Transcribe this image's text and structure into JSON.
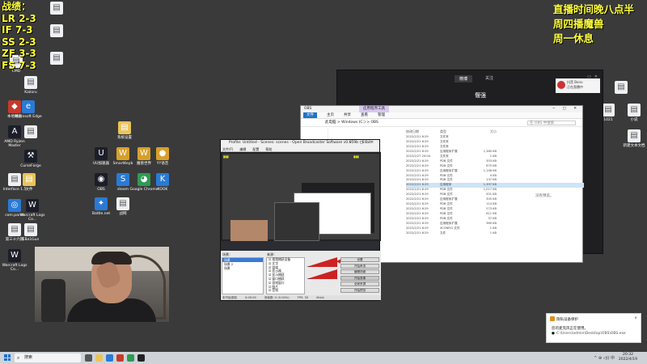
{
  "overlay": {
    "left_lines": [
      "战绩：",
      "LR 2-3",
      "IF 7-3",
      "SS 2-3",
      "ZF 3-3",
      "FS 7-3"
    ],
    "right_lines": [
      "直播时间晚八点半",
      "周四播魔兽",
      "周一休息"
    ]
  },
  "desktop_icons": [
    {
      "label": "",
      "glyph": "▤",
      "style": "g-doc"
    },
    {
      "label": "CMD",
      "glyph": "▤",
      "style": "g-doc"
    },
    {
      "label": "",
      "glyph": "▤",
      "style": "g-doc"
    },
    {
      "label": "",
      "glyph": "▤",
      "style": "g-doc"
    },
    {
      "label": "Kailoru",
      "glyph": "▤",
      "style": "g-doc"
    },
    {
      "label": "本地磁盘",
      "glyph": "◆",
      "style": "g-red"
    },
    {
      "label": "Microsoft Edge",
      "glyph": "e",
      "style": "g-blue"
    },
    {
      "label": "AMD Ryzen Master",
      "glyph": "A",
      "style": "g-dark"
    },
    {
      "label": "",
      "glyph": "▤",
      "style": "g-doc"
    },
    {
      "label": "CurseForge",
      "glyph": "⚒",
      "style": "g-dark"
    },
    {
      "label": "Interface 1.5",
      "glyph": "▤",
      "style": "g-doc"
    },
    {
      "label": "文件",
      "glyph": "▤",
      "style": "g-folder"
    },
    {
      "label": "com.parse",
      "glyph": "◎",
      "style": "g-blue"
    },
    {
      "label": "Warcraft Logs Co...",
      "glyph": "W",
      "style": "g-dark"
    },
    {
      "label": "第三十六期",
      "glyph": "▤",
      "style": "g-doc"
    },
    {
      "label": "Warcraft Logs Co...",
      "glyph": "W",
      "style": "g-dark"
    },
    {
      "label": "EBa1Gun",
      "glyph": "▤",
      "style": "g-doc"
    },
    {
      "label": "系统设置",
      "glyph": "▤",
      "style": "g-folder"
    },
    {
      "label": "UU加速器",
      "glyph": "U",
      "style": "g-dark"
    },
    {
      "label": "SmartKeyb",
      "glyph": "W",
      "style": "g-gold"
    },
    {
      "label": "OBS",
      "glyph": "◉",
      "style": "g-dark"
    },
    {
      "label": "steam",
      "glyph": "S",
      "style": "g-blue"
    },
    {
      "label": "Battle.net",
      "glyph": "✦",
      "style": "g-blue"
    },
    {
      "label": "战网",
      "glyph": "▤",
      "style": "g-doc"
    },
    {
      "label": "魔兽世界",
      "glyph": "W",
      "style": "g-gold"
    },
    {
      "label": "Google Chrome",
      "glyph": "◕",
      "style": "g-green"
    },
    {
      "label": "YY语音",
      "glyph": "●",
      "style": "g-gold"
    },
    {
      "label": "KOOK",
      "glyph": "K",
      "style": "g-blue"
    },
    {
      "label": "",
      "glyph": "▤",
      "style": "g-doc"
    },
    {
      "label": "新建文本文档",
      "glyph": "▤",
      "style": "g-doc"
    },
    {
      "label": "1021",
      "glyph": "▤",
      "style": "g-doc"
    },
    {
      "label": "小说",
      "glyph": "▤",
      "style": "g-doc"
    }
  ],
  "player": {
    "tabs": [
      "微博",
      "关注"
    ],
    "nick": "偃强",
    "notice_title": "抖音 Bonu",
    "notice_sub": "正在直播中"
  },
  "explorer": {
    "title": "OBS",
    "tool_tab": "应用程序工具",
    "ribbon": [
      "文件",
      "主页",
      "共享",
      "查看",
      "管理"
    ],
    "address": "此电脑 > Windows (C:) > OBS",
    "search_placeholder": "在 OBS 中搜索",
    "col_date": "修改日期",
    "col_type": "类型",
    "col_size": "大小",
    "rows": [
      {
        "date": "2022/2/21 6:29",
        "type": "文件夹",
        "size": ""
      },
      {
        "date": "2022/2/21 6:29",
        "type": "文件夹",
        "size": ""
      },
      {
        "date": "2022/2/21 6:29",
        "type": "文件夹",
        "size": ""
      },
      {
        "date": "2022/2/21 6:29",
        "type": "应用程序扩展",
        "size": "1,380 KB"
      },
      {
        "date": "2022/2/27 20:04",
        "type": "文件夹",
        "size": "1 KB"
      },
      {
        "date": "2022/2/21 6:29",
        "type": "PDB 文件",
        "size": "353 KB"
      },
      {
        "date": "2022/2/21 6:29",
        "type": "PDB 文件",
        "size": "675 KB"
      },
      {
        "date": "2022/2/21 6:29",
        "type": "应用程序扩展",
        "size": "1,148 KB"
      },
      {
        "date": "2022/2/21 6:29",
        "type": "PDB 文件",
        "size": "4 KB"
      },
      {
        "date": "2022/2/21 6:29",
        "type": "PDB 文件",
        "size": "137 KB"
      },
      {
        "date": "2022/2/21 6:29",
        "type": "应用程序",
        "size": "1,397 KB"
      },
      {
        "date": "2022/2/21 6:29",
        "type": "PDB 文件",
        "size": "1,017 KB"
      },
      {
        "date": "2022/2/21 6:29",
        "type": "PDB 文件",
        "size": "501 KB"
      },
      {
        "date": "2022/2/21 6:29",
        "type": "应用程序扩展",
        "size": "305 KB"
      },
      {
        "date": "2022/2/21 6:29",
        "type": "PDB 文件",
        "size": "114 KB"
      },
      {
        "date": "2022/2/21 6:29",
        "type": "PDB 文件",
        "size": "273 KB"
      },
      {
        "date": "2022/2/21 6:29",
        "type": "PDB 文件",
        "size": "611 KB"
      },
      {
        "date": "2022/2/21 6:29",
        "type": "PDB 文件",
        "size": "37 KB"
      },
      {
        "date": "2022/2/21 6:29",
        "type": "应用程序扩展",
        "size": "369 KB"
      },
      {
        "date": "2022/2/21 6:29",
        "type": "XCONFIG 文件",
        "size": "1 KB"
      },
      {
        "date": "2022/2/21 6:29",
        "type": "文件",
        "size": "1 KB"
      }
    ],
    "selected_row": 10,
    "preview_note": "没有预览。"
  },
  "obs": {
    "title": "Profile: Untitled - Scenes: scenes - Open Broadcaster Software v0.659b - 64bit",
    "menu": [
      "文件(F)",
      "编辑",
      "配置",
      "帮助"
    ],
    "scenes_label": "场景：",
    "sources_label": "来源：",
    "scenes": [
      "场景",
      "场景 2",
      "场景"
    ],
    "sources": [
      "视频捕获设备",
      "文字",
      "游戏",
      "显示器",
      "显示捕获",
      "窗口捕获",
      "游戏窗口",
      "图片",
      "音频"
    ],
    "buttons": [
      "设置",
      "开始串流",
      "编辑场景",
      "开始录像",
      "全局来源",
      "开始预览",
      "插件",
      "退出"
    ],
    "status": [
      "未开始录制",
      "0:00:00",
      "丢帧数: 0 (0.00%)",
      "FPS: 30",
      "0kb/s"
    ]
  },
  "notification": {
    "title": "隐私设备保护",
    "body": "您的麦克风正在使用。",
    "path": "C:\\Users\\admin\\Desktop\\OBS\\OBS.exe",
    "close": "×"
  },
  "taskbar": {
    "search_placeholder": "搜索",
    "time": "20:32",
    "date": "2022/4/19",
    "tray": "^ ⊕ ◁)) 中"
  }
}
